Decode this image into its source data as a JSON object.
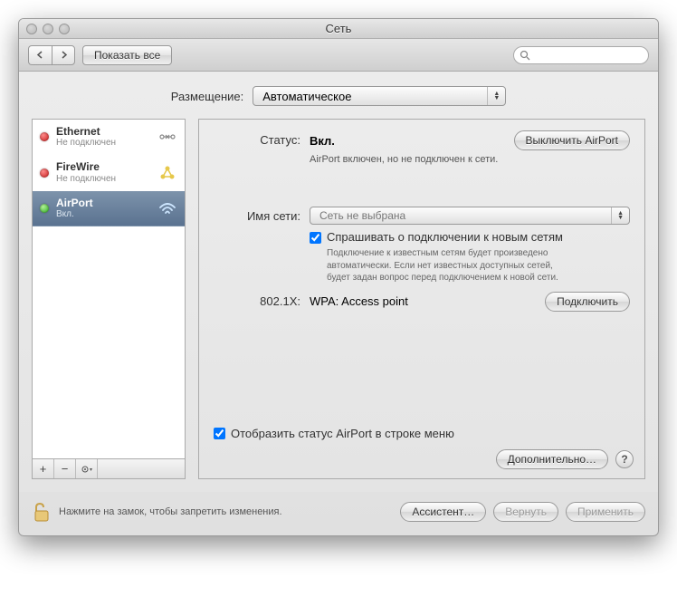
{
  "window": {
    "title": "Сеть"
  },
  "toolbar": {
    "show_all": "Показать все",
    "search_placeholder": "Q"
  },
  "location": {
    "label": "Размещение:",
    "value": "Автоматическое"
  },
  "sidebar": {
    "items": [
      {
        "name": "Ethernet",
        "status": "Не подключен",
        "dot": "red",
        "icon": "ethernet"
      },
      {
        "name": "FireWire",
        "status": "Не подключен",
        "dot": "red",
        "icon": "firewire"
      },
      {
        "name": "AirPort",
        "status": "Вкл.",
        "dot": "green",
        "icon": "wifi"
      }
    ]
  },
  "detail": {
    "status_label": "Статус:",
    "status_value": "Вкл.",
    "status_sub": "AirPort включен, но не подключен к сети.",
    "toggle_btn": "Выключить AirPort",
    "network_label": "Имя сети:",
    "network_value": "Сеть не выбрана",
    "ask_label": "Спрашивать о подключении к новым сетям",
    "ask_desc": "Подключение к известным сетям будет произведено автоматически. Если нет известных доступных сетей, будет задан вопрос перед подключением к новой сети.",
    "dot1x_label": "802.1X:",
    "dot1x_value": "WPA: Access point",
    "connect_btn": "Подключить",
    "show_menu": "Отобразить статус AirPort в строке меню",
    "advanced_btn": "Дополнительно…"
  },
  "footer": {
    "lock_text": "Нажмите на замок, чтобы запретить изменения.",
    "assist": "Ассистент…",
    "revert": "Вернуть",
    "apply": "Применить"
  }
}
